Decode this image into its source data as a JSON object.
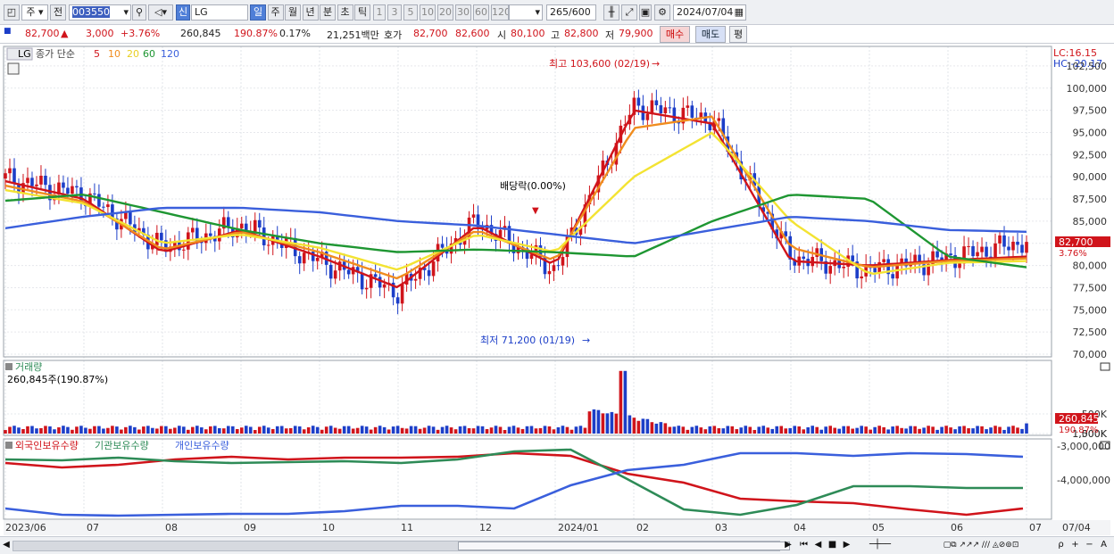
{
  "toolbar": {
    "market_label": "주",
    "all_label": "전",
    "code": "003550",
    "new_label": "신",
    "name": "LG",
    "periods": [
      "일",
      "주",
      "월",
      "년",
      "분",
      "초",
      "틱"
    ],
    "active_period": "일",
    "intervals": [
      "1",
      "3",
      "5",
      "10",
      "20",
      "30",
      "60",
      "120"
    ],
    "count": "265",
    "count_max": "/600",
    "date": "2024/07/04"
  },
  "quote": {
    "price": "82,700",
    "up_mark": "▲",
    "change": "3,000",
    "change_pct": "+3.76%",
    "volume": "260,845",
    "volume_ratio": "190.87%",
    "turnover": "0.17%",
    "amount": "21,251백만",
    "bid_label": "호가",
    "ask": "82,700",
    "bid": "82,600",
    "open_label": "시",
    "open": "80,100",
    "high_label": "고",
    "high": "82,800",
    "low_label": "저",
    "low": "79,900",
    "buy_label": "매수",
    "sell_label": "매도",
    "eval_label": "평"
  },
  "price_pane": {
    "tag": "LG",
    "legend": {
      "label": "종가 단순",
      "ma": [
        "5",
        "10",
        "20",
        "60",
        "120"
      ]
    },
    "lc": "LC:16.15",
    "hc": "HC:-20.17",
    "y_ticks": [
      "102,500",
      "100,000",
      "97,500",
      "95,000",
      "92,500",
      "90,000",
      "87,500",
      "85,000",
      "82,500",
      "80,000",
      "77,500",
      "75,000",
      "72,500",
      "70,000"
    ],
    "last_price": "82,700",
    "last_pct": "3.76%",
    "high_note": "최고 103,600 (02/19)",
    "low_note": "최저 71,200 (01/19)",
    "div_note": "배당락(0.00%)"
  },
  "volume_pane": {
    "title": "거래량",
    "value": "260,845주(190.87%)",
    "y_ticks": [
      "1,500K",
      "1,000K",
      "500K"
    ],
    "last": "260,845",
    "last_pct": "190.87%"
  },
  "holding_pane": {
    "legend": [
      "외국인보유수량",
      "기관보유수량",
      "개인보유수량"
    ],
    "y_ticks": [
      "-3,000,000",
      "-4,000,000"
    ]
  },
  "x_ticks": [
    "2023/06",
    "07",
    "08",
    "09",
    "10",
    "11",
    "12",
    "2024/01",
    "02",
    "03",
    "04",
    "05",
    "06",
    "07",
    "07/04"
  ],
  "colors": {
    "up": "#d0141b",
    "down": "#1c3ec8",
    "ma5": "#d0141b",
    "ma10": "#f08c1e",
    "ma20": "#f3e332",
    "ma60": "#1e9632",
    "ma120": "#3a5fdc",
    "foreign": "#d0141b",
    "inst": "#2e8b57",
    "indiv": "#3a5fdc"
  },
  "chart_data": {
    "type": "line",
    "title": "LG",
    "x": [
      "2023/06",
      "07",
      "08",
      "09",
      "10",
      "11",
      "12",
      "2024/01",
      "02",
      "03",
      "04",
      "05",
      "06",
      "07"
    ],
    "series": [
      {
        "name": "종가",
        "values": [
          89800,
          88000,
          82000,
          84500,
          80500,
          77000,
          85000,
          79500,
          98000,
          96500,
          81000,
          79500,
          80800,
          82700
        ]
      },
      {
        "name": "5",
        "values": [
          89500,
          87500,
          81500,
          84000,
          81000,
          77500,
          84500,
          80000,
          97500,
          96000,
          80500,
          80000,
          80600,
          81000
        ]
      },
      {
        "name": "10",
        "values": [
          89000,
          87200,
          81800,
          83800,
          81500,
          78500,
          84000,
          80500,
          95500,
          96800,
          82000,
          79800,
          80500,
          80800
        ]
      },
      {
        "name": "20",
        "values": [
          88500,
          87000,
          82500,
          83500,
          82000,
          79500,
          83500,
          81500,
          90000,
          95000,
          85000,
          79000,
          80300,
          80500
        ]
      },
      {
        "name": "60",
        "values": [
          87300,
          88000,
          86000,
          84000,
          82500,
          81500,
          81800,
          81500,
          81000,
          85000,
          88000,
          87500,
          81000,
          79800
        ]
      },
      {
        "name": "120",
        "values": [
          84200,
          85500,
          86500,
          86500,
          86000,
          85000,
          84500,
          83500,
          82500,
          84000,
          85500,
          85000,
          84000,
          83800
        ]
      }
    ],
    "highlights": {
      "high": 103600,
      "high_date": "02/19",
      "low": 71200,
      "low_date": "01/19",
      "close": 82700,
      "change": 3000,
      "change_pct": 3.76
    },
    "ylim": [
      70000,
      104000
    ],
    "volume": {
      "last": 260845,
      "ylim": [
        0,
        1800000
      ]
    }
  }
}
